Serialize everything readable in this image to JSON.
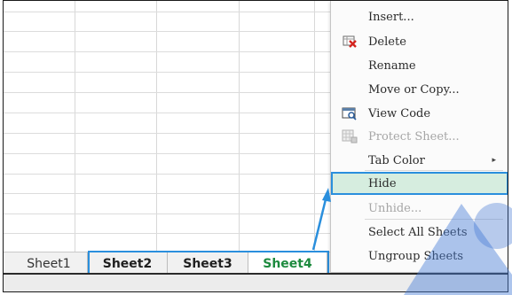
{
  "sheet_tabs": [
    {
      "label": "Sheet1"
    },
    {
      "label": "Sheet2"
    },
    {
      "label": "Sheet3"
    },
    {
      "label": "Sheet4"
    }
  ],
  "context_menu": {
    "items": [
      {
        "label": "Insert...",
        "icon": "none"
      },
      {
        "label": "Delete",
        "icon": "delete-sheet-icon"
      },
      {
        "label": "Rename",
        "icon": "none"
      },
      {
        "label": "Move or Copy...",
        "icon": "none"
      },
      {
        "label": "View Code",
        "icon": "view-code-icon"
      },
      {
        "label": "Protect Sheet...",
        "icon": "protect-sheet-icon",
        "disabled": true
      },
      {
        "label": "Tab Color",
        "icon": "none",
        "submenu": true
      },
      {
        "label": "Hide",
        "icon": "none",
        "highlighted": true
      },
      {
        "label": "Unhide...",
        "icon": "none",
        "disabled": true
      },
      {
        "label": "Select All Sheets",
        "icon": "none"
      },
      {
        "label": "Ungroup Sheets",
        "icon": "none"
      }
    ],
    "submenu_arrow": "▸"
  },
  "colors": {
    "highlight_border": "#2a8fdd",
    "highlight_fill": "#d6eddf",
    "active_tab_text": "#1d8a3e"
  }
}
